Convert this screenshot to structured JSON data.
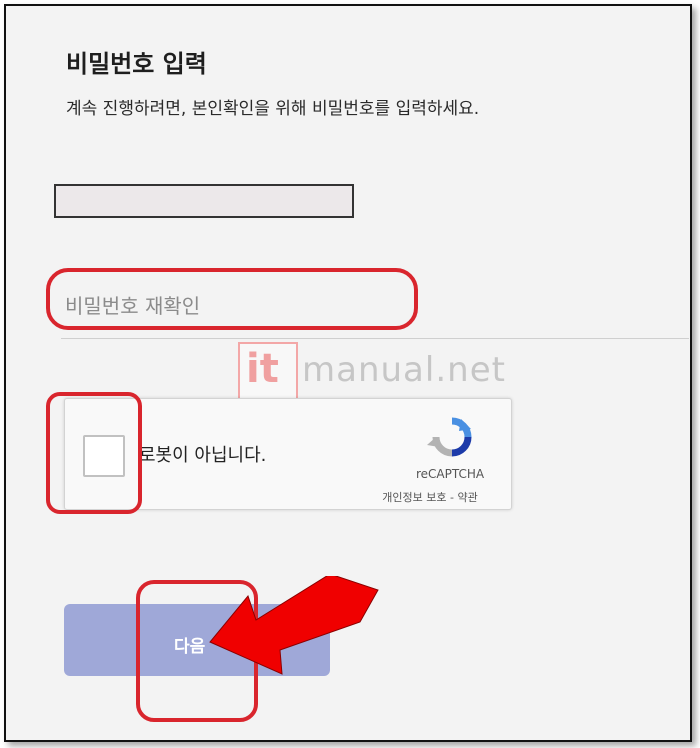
{
  "page": {
    "title": "비밀번호 입력",
    "subtitle": "계속 진행하려면, 본인확인을 위해 비밀번호를 입력하세요."
  },
  "password_confirm": {
    "placeholder": "비밀번호 재확인"
  },
  "watermark": {
    "mark": "it",
    "text": "manual.net"
  },
  "recaptcha": {
    "checkbox_label": "로봇이 아닙니다.",
    "brand": "reCAPTCHA",
    "links": "개인정보 보호 - 약관"
  },
  "next_button": {
    "label": "다음"
  },
  "colors": {
    "annotation": "#d9252d",
    "button": "#9fa8d8",
    "arrow": "#f00000"
  }
}
